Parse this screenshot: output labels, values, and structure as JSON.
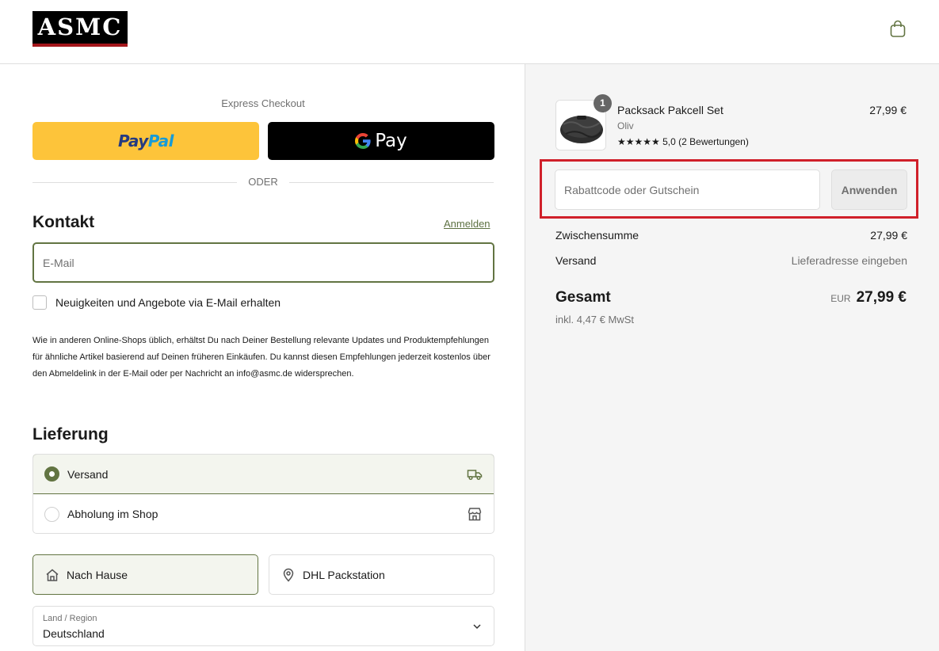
{
  "header": {
    "logo_text": "ASMC",
    "cart_icon": "shopping-bag-icon"
  },
  "express": {
    "title": "Express Checkout",
    "paypal_label_1": "Pay",
    "paypal_label_2": "Pal",
    "gpay_label": "Pay",
    "divider_label": "ODER"
  },
  "contact": {
    "heading": "Kontakt",
    "login_link": "Anmelden",
    "email_placeholder": "E-Mail",
    "newsletter_label": "Neuigkeiten und Angebote via E-Mail erhalten",
    "legal_text": "Wie in anderen Online-Shops üblich, erhältst Du nach Deiner Bestellung relevante Updates und Produktempfehlungen für ähnliche Artikel basierend auf Deinen früheren Einkäufen. Du kannst diesen Empfehlungen jederzeit kostenlos über den Abmeldelink in der E-Mail oder per Nachricht an info@asmc.de widersprechen."
  },
  "delivery": {
    "heading": "Lieferung",
    "options": [
      {
        "label": "Versand",
        "selected": true,
        "icon": "delivery-truck-icon"
      },
      {
        "label": "Abholung im Shop",
        "selected": false,
        "icon": "store-icon"
      }
    ],
    "address_types": [
      {
        "label": "Nach Hause",
        "selected": true,
        "icon": "home-icon"
      },
      {
        "label": "DHL Packstation",
        "selected": false,
        "icon": "location-pin-icon"
      }
    ],
    "country_label": "Land / Region",
    "country_value": "Deutschland"
  },
  "summary": {
    "product": {
      "name": "Packsack Pakcell Set",
      "variant": "Oliv",
      "rating": "★★★★★  5,0 (2 Bewertungen)",
      "price": "27,99 €",
      "quantity": "1"
    },
    "discount_placeholder": "Rabattcode oder Gutschein",
    "apply_label": "Anwenden",
    "subtotal_label": "Zwischensumme",
    "subtotal_value": "27,99 €",
    "shipping_label": "Versand",
    "shipping_value": "Lieferadresse eingeben",
    "total_label": "Gesamt",
    "currency": "EUR",
    "total_value": "27,99 €",
    "vat_text": "inkl. 4,47 € MwSt"
  },
  "colors": {
    "accent": "#627442",
    "highlight": "#d0202a",
    "paypal_yellow": "#fdc43a"
  }
}
